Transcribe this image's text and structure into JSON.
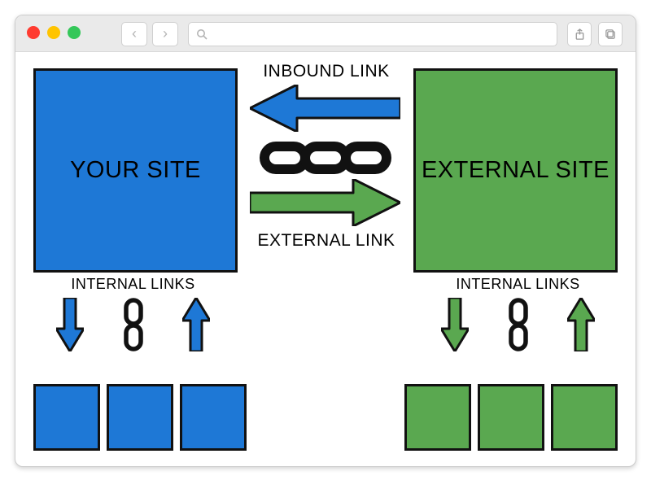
{
  "colors": {
    "blue": "#1e78d6",
    "green": "#5aa850",
    "stroke": "#111"
  },
  "your_site": {
    "label": "YOUR SITE",
    "internal_links_label": "INTERNAL LINKS"
  },
  "external_site": {
    "label": "EXTERNAL SITE",
    "internal_links_label": "INTERNAL LINKS"
  },
  "links": {
    "inbound_label": "INBOUND LINK",
    "external_label": "EXTERNAL LINK"
  }
}
